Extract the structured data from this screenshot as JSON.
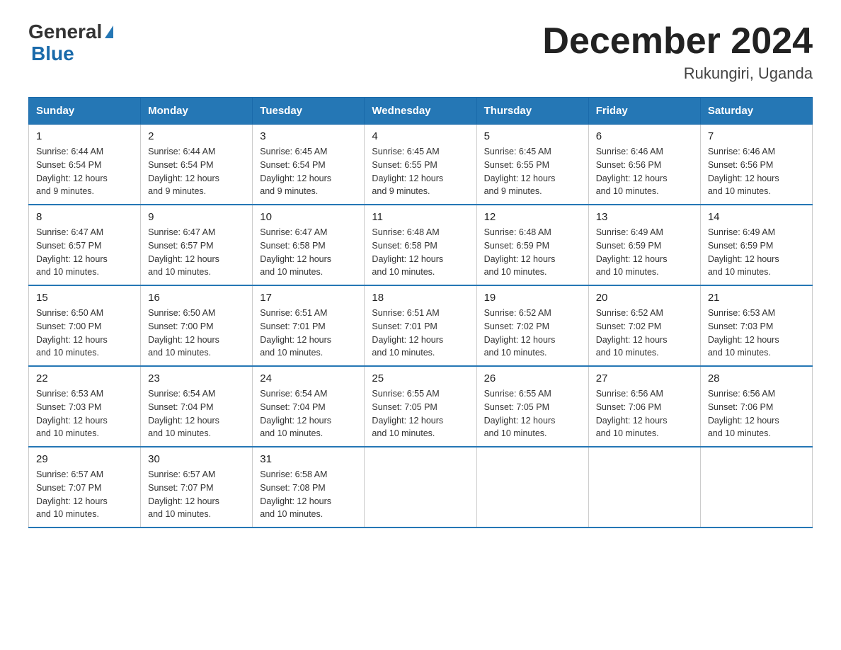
{
  "logo": {
    "text_general": "General",
    "text_blue": "Blue"
  },
  "title": "December 2024",
  "subtitle": "Rukungiri, Uganda",
  "days_of_week": [
    "Sunday",
    "Monday",
    "Tuesday",
    "Wednesday",
    "Thursday",
    "Friday",
    "Saturday"
  ],
  "weeks": [
    [
      {
        "day": "1",
        "sunrise": "6:44 AM",
        "sunset": "6:54 PM",
        "daylight": "12 hours and 9 minutes."
      },
      {
        "day": "2",
        "sunrise": "6:44 AM",
        "sunset": "6:54 PM",
        "daylight": "12 hours and 9 minutes."
      },
      {
        "day": "3",
        "sunrise": "6:45 AM",
        "sunset": "6:54 PM",
        "daylight": "12 hours and 9 minutes."
      },
      {
        "day": "4",
        "sunrise": "6:45 AM",
        "sunset": "6:55 PM",
        "daylight": "12 hours and 9 minutes."
      },
      {
        "day": "5",
        "sunrise": "6:45 AM",
        "sunset": "6:55 PM",
        "daylight": "12 hours and 9 minutes."
      },
      {
        "day": "6",
        "sunrise": "6:46 AM",
        "sunset": "6:56 PM",
        "daylight": "12 hours and 10 minutes."
      },
      {
        "day": "7",
        "sunrise": "6:46 AM",
        "sunset": "6:56 PM",
        "daylight": "12 hours and 10 minutes."
      }
    ],
    [
      {
        "day": "8",
        "sunrise": "6:47 AM",
        "sunset": "6:57 PM",
        "daylight": "12 hours and 10 minutes."
      },
      {
        "day": "9",
        "sunrise": "6:47 AM",
        "sunset": "6:57 PM",
        "daylight": "12 hours and 10 minutes."
      },
      {
        "day": "10",
        "sunrise": "6:47 AM",
        "sunset": "6:58 PM",
        "daylight": "12 hours and 10 minutes."
      },
      {
        "day": "11",
        "sunrise": "6:48 AM",
        "sunset": "6:58 PM",
        "daylight": "12 hours and 10 minutes."
      },
      {
        "day": "12",
        "sunrise": "6:48 AM",
        "sunset": "6:59 PM",
        "daylight": "12 hours and 10 minutes."
      },
      {
        "day": "13",
        "sunrise": "6:49 AM",
        "sunset": "6:59 PM",
        "daylight": "12 hours and 10 minutes."
      },
      {
        "day": "14",
        "sunrise": "6:49 AM",
        "sunset": "6:59 PM",
        "daylight": "12 hours and 10 minutes."
      }
    ],
    [
      {
        "day": "15",
        "sunrise": "6:50 AM",
        "sunset": "7:00 PM",
        "daylight": "12 hours and 10 minutes."
      },
      {
        "day": "16",
        "sunrise": "6:50 AM",
        "sunset": "7:00 PM",
        "daylight": "12 hours and 10 minutes."
      },
      {
        "day": "17",
        "sunrise": "6:51 AM",
        "sunset": "7:01 PM",
        "daylight": "12 hours and 10 minutes."
      },
      {
        "day": "18",
        "sunrise": "6:51 AM",
        "sunset": "7:01 PM",
        "daylight": "12 hours and 10 minutes."
      },
      {
        "day": "19",
        "sunrise": "6:52 AM",
        "sunset": "7:02 PM",
        "daylight": "12 hours and 10 minutes."
      },
      {
        "day": "20",
        "sunrise": "6:52 AM",
        "sunset": "7:02 PM",
        "daylight": "12 hours and 10 minutes."
      },
      {
        "day": "21",
        "sunrise": "6:53 AM",
        "sunset": "7:03 PM",
        "daylight": "12 hours and 10 minutes."
      }
    ],
    [
      {
        "day": "22",
        "sunrise": "6:53 AM",
        "sunset": "7:03 PM",
        "daylight": "12 hours and 10 minutes."
      },
      {
        "day": "23",
        "sunrise": "6:54 AM",
        "sunset": "7:04 PM",
        "daylight": "12 hours and 10 minutes."
      },
      {
        "day": "24",
        "sunrise": "6:54 AM",
        "sunset": "7:04 PM",
        "daylight": "12 hours and 10 minutes."
      },
      {
        "day": "25",
        "sunrise": "6:55 AM",
        "sunset": "7:05 PM",
        "daylight": "12 hours and 10 minutes."
      },
      {
        "day": "26",
        "sunrise": "6:55 AM",
        "sunset": "7:05 PM",
        "daylight": "12 hours and 10 minutes."
      },
      {
        "day": "27",
        "sunrise": "6:56 AM",
        "sunset": "7:06 PM",
        "daylight": "12 hours and 10 minutes."
      },
      {
        "day": "28",
        "sunrise": "6:56 AM",
        "sunset": "7:06 PM",
        "daylight": "12 hours and 10 minutes."
      }
    ],
    [
      {
        "day": "29",
        "sunrise": "6:57 AM",
        "sunset": "7:07 PM",
        "daylight": "12 hours and 10 minutes."
      },
      {
        "day": "30",
        "sunrise": "6:57 AM",
        "sunset": "7:07 PM",
        "daylight": "12 hours and 10 minutes."
      },
      {
        "day": "31",
        "sunrise": "6:58 AM",
        "sunset": "7:08 PM",
        "daylight": "12 hours and 10 minutes."
      },
      null,
      null,
      null,
      null
    ]
  ],
  "labels": {
    "sunrise": "Sunrise:",
    "sunset": "Sunset:",
    "daylight": "Daylight:"
  }
}
